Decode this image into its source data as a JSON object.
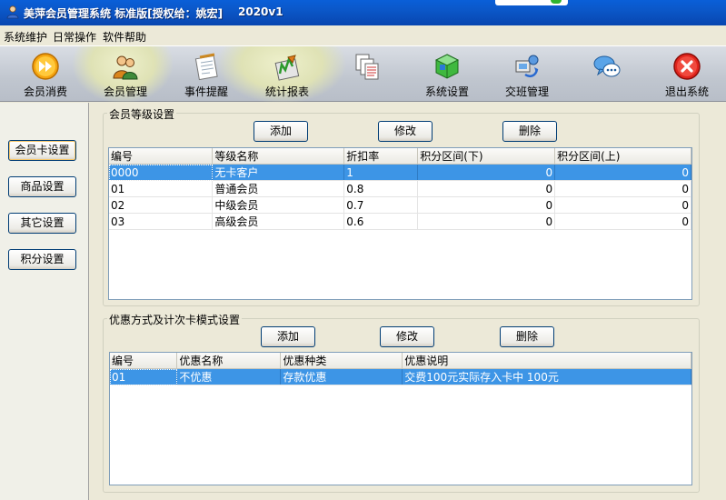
{
  "window": {
    "title": "美萍会员管理系统 标准版[授权给：姚宏]",
    "version": "2020v1"
  },
  "menu": [
    "系统维护",
    "日常操作",
    "软件帮助"
  ],
  "toolbar": [
    {
      "label": "会员消费",
      "icon": "play-icon"
    },
    {
      "label": "会员管理",
      "icon": "members-icon"
    },
    {
      "label": "事件提醒",
      "icon": "notepad-icon"
    },
    {
      "label": "统计报表",
      "icon": "chart-icon"
    },
    {
      "label": "",
      "icon": "reports-icon"
    },
    {
      "label": "系统设置",
      "icon": "cube-icon"
    },
    {
      "label": "交班管理",
      "icon": "shift-icon"
    },
    {
      "label": "",
      "icon": "chat-icon"
    },
    {
      "label": "退出系统",
      "icon": "exit-icon"
    }
  ],
  "sidebar": [
    "会员卡设置",
    "商品设置",
    "其它设置",
    "积分设置"
  ],
  "level_group": {
    "legend": "会员等级设置",
    "buttons": {
      "add": "添加",
      "edit": "修改",
      "delete": "删除"
    },
    "columns": [
      "编号",
      "等级名称",
      "折扣率",
      "积分区间(下)",
      "积分区间(上)"
    ],
    "rows": [
      [
        "0000",
        "无卡客户",
        "1",
        "0",
        "0"
      ],
      [
        "01",
        "普通会员",
        "0.8",
        "0",
        "0"
      ],
      [
        "02",
        "中级会员",
        "0.7",
        "0",
        "0"
      ],
      [
        "03",
        "高级会员",
        "0.6",
        "0",
        "0"
      ]
    ],
    "selected_row": 0
  },
  "discount_group": {
    "legend": "优惠方式及计次卡模式设置",
    "buttons": {
      "add": "添加",
      "edit": "修改",
      "delete": "删除"
    },
    "columns": [
      "编号",
      "优惠名称",
      "优惠种类",
      "优惠说明"
    ],
    "rows": [
      [
        "01",
        "不优惠",
        "存款优惠",
        "交费100元实际存入卡中  100元"
      ]
    ],
    "selected_row": 0
  },
  "colors": {
    "titlebar": "#0b57c8",
    "selection": "#3d95e6",
    "exit_red": "#e0241c"
  }
}
